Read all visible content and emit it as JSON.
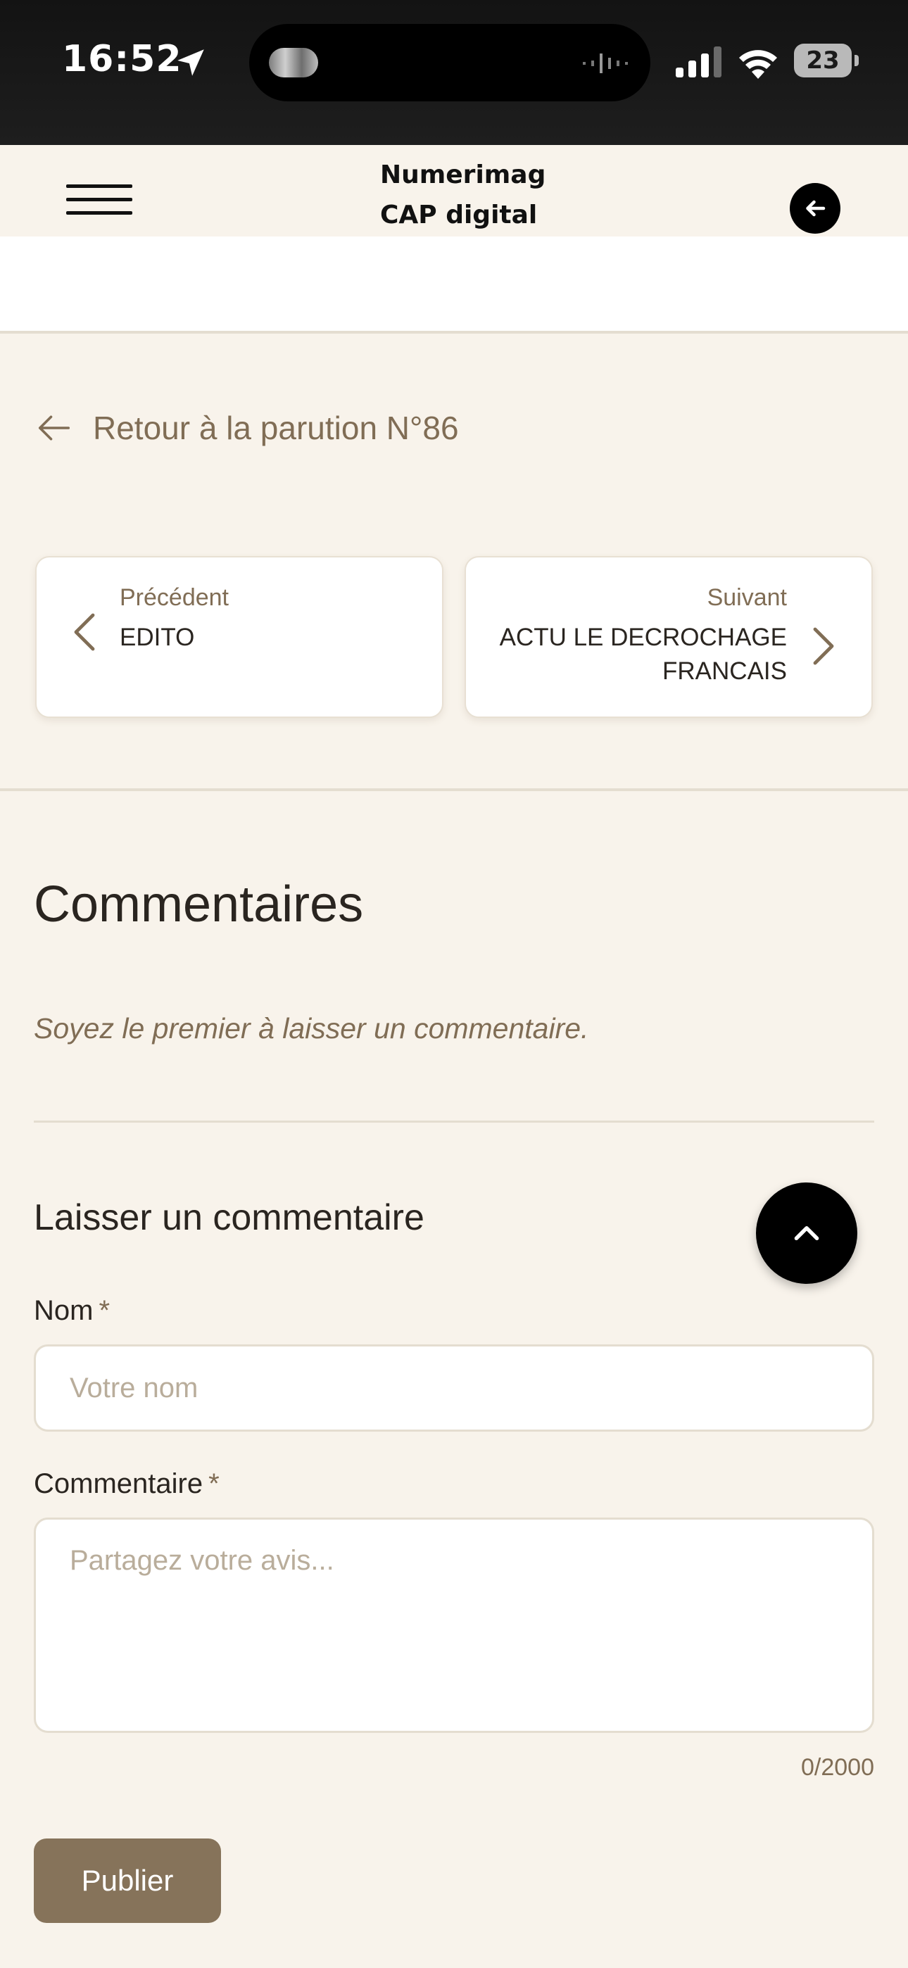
{
  "status_bar": {
    "time": "16:52",
    "battery": "23",
    "icons": [
      "location-arrow-icon",
      "audio-wave-icon",
      "signal-icon",
      "wifi-icon",
      "battery-icon"
    ]
  },
  "header": {
    "title_line1": "Numerimag",
    "title_line2": "CAP digital",
    "icons": [
      "hamburger-menu-icon",
      "arrow-left-icon"
    ]
  },
  "return_link": {
    "label": "Retour à la parution N°86"
  },
  "navigation": {
    "previous": {
      "caption": "Précédent",
      "title": "EDITO"
    },
    "next": {
      "caption": "Suivant",
      "title": "ACTU LE DECROCHAGE FRANCAIS"
    }
  },
  "comments": {
    "title": "Commentaires",
    "empty_message": "Soyez le premier à laisser un commentaire.",
    "form": {
      "title": "Laisser un commentaire",
      "name_label": "Nom",
      "name_placeholder": "Votre nom",
      "comment_label": "Commentaire",
      "comment_placeholder": "Partagez votre avis...",
      "required_mark": "*",
      "counter": "0/2000",
      "submit_label": "Publier"
    }
  },
  "colors": {
    "background": "#f8f3eb",
    "accent": "#86735a",
    "muted_text": "#806d55",
    "border": "#e4ddd0"
  }
}
